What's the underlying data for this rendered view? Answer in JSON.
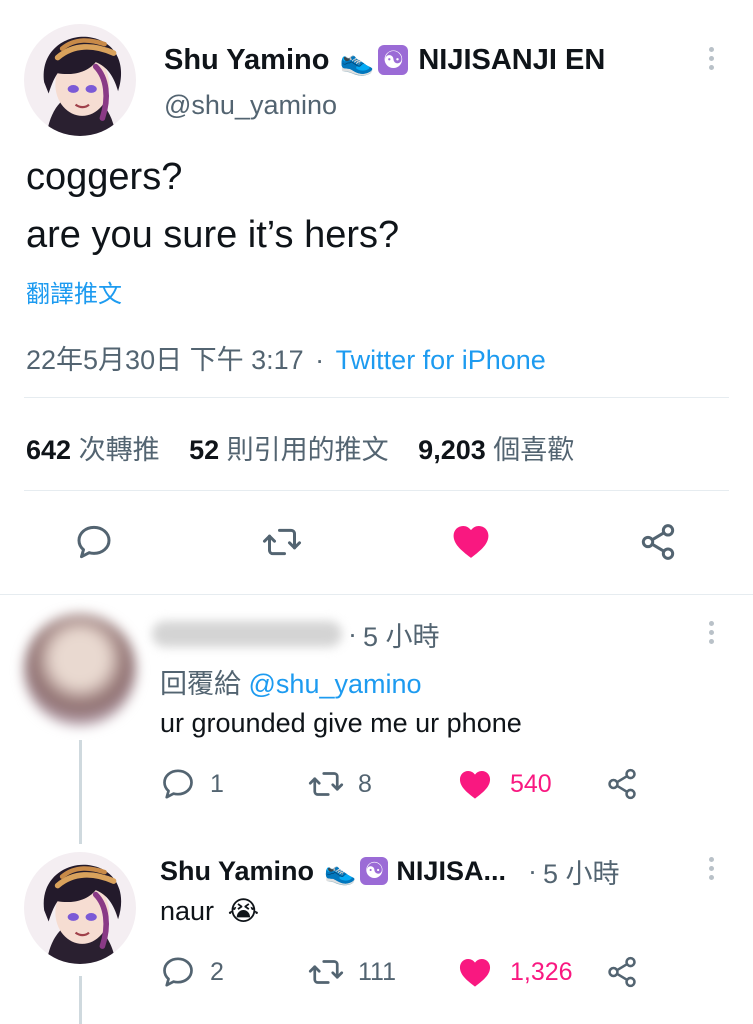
{
  "main_tweet": {
    "author_name": "Shu Yamino",
    "shoe_emoji": "👟",
    "yin_yang_emoji": "☯",
    "org_label": "NIJISANJI EN",
    "handle": "@shu_yamino",
    "text_line1": "coggers?",
    "text_line2": "are you sure it’s hers?",
    "translate_label": "翻譯推文",
    "date": "22年5月30日 下午 3:17",
    "separator": "·",
    "client": "Twitter for iPhone",
    "retweets_count": "642",
    "retweets_label": "次轉推",
    "quotes_count": "52",
    "quotes_label": "則引用的推文",
    "likes_count": "9,203",
    "likes_label": "個喜歡",
    "liked": true
  },
  "replies": [
    {
      "author_name": "",
      "time_sep": "·",
      "time": "5 小時",
      "reply_to_prefix": "回覆給",
      "reply_to_handle": "@shu_yamino",
      "text": "ur grounded give me ur phone",
      "reply_count": "1",
      "retweet_count": "8",
      "like_count": "540",
      "liked": true
    },
    {
      "author_name": "Shu Yamino",
      "shoe_emoji": "👟",
      "yin_yang_emoji": "☯",
      "org_label": "NIJISA...",
      "time_sep": "·",
      "time": "5 小時",
      "text": "naur",
      "emoji": "😭",
      "reply_count": "2",
      "retweet_count": "111",
      "like_count": "1,326",
      "liked": true
    }
  ],
  "colors": {
    "accent_blue": "#1d9bf0",
    "like_pink": "#f91880",
    "secondary_grey": "#536471",
    "divider": "#e6ecf0"
  },
  "icons": [
    "reply-icon",
    "retweet-icon",
    "like-icon",
    "share-icon",
    "more-icon"
  ]
}
